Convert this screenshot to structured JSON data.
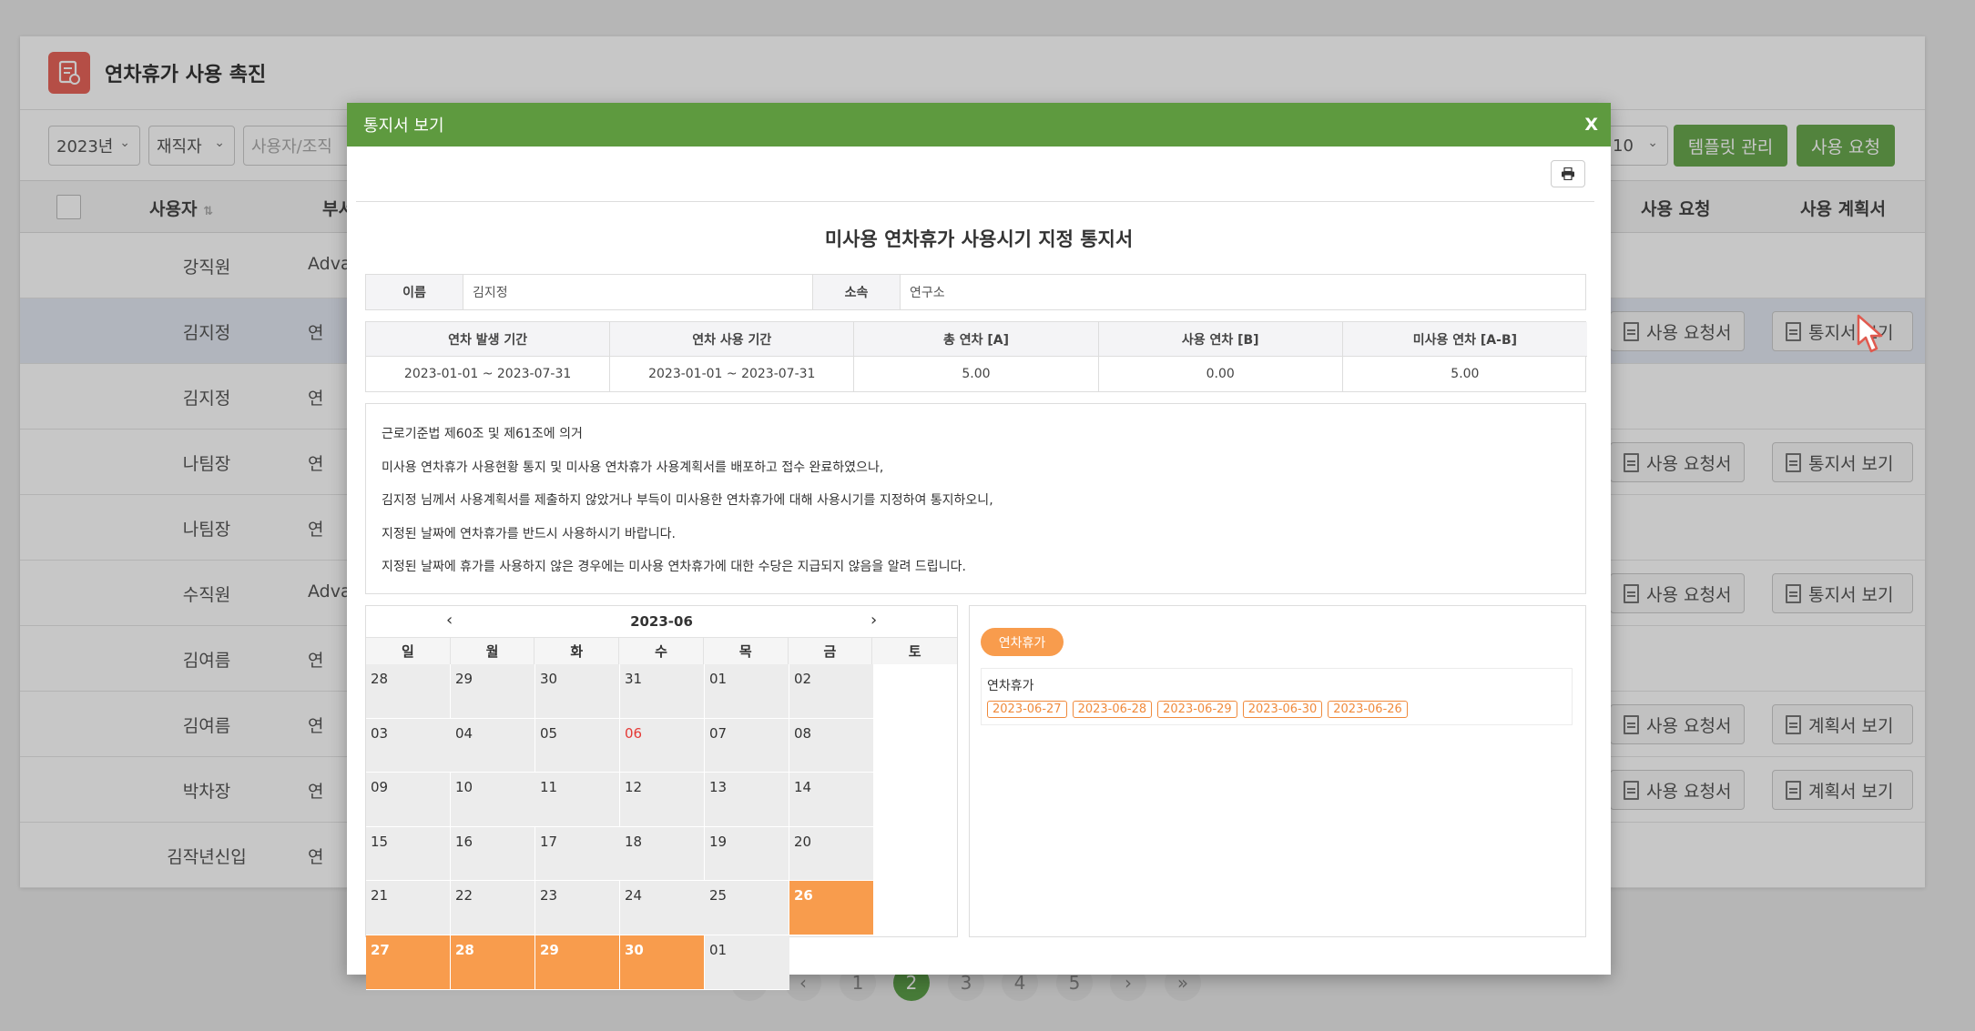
{
  "page": {
    "title": "연차휴가 사용 촉진",
    "toolbar": {
      "year": "2023년",
      "status": "재직자",
      "search_placeholder": "사용자/조직",
      "page_size": "10",
      "template_button": "템플릿 관리",
      "request_button": "사용 요청"
    },
    "table": {
      "headers": {
        "user": "사용자",
        "dept": "부서",
        "request": "사용 요청",
        "plan": "사용 계획서"
      },
      "rows": [
        {
          "user": "강직원",
          "dept": "Adva",
          "req": "",
          "plan": ""
        },
        {
          "user": "김지정",
          "dept": "연",
          "req": "사용 요청서",
          "plan": "통지서 보기"
        },
        {
          "user": "김지정",
          "dept": "연",
          "req": "",
          "plan": ""
        },
        {
          "user": "나팀장",
          "dept": "연",
          "req": "사용 요청서",
          "plan": "통지서 보기"
        },
        {
          "user": "나팀장",
          "dept": "연",
          "req": "",
          "plan": ""
        },
        {
          "user": "수직원",
          "dept": "Adva",
          "req": "사용 요청서",
          "plan": "통지서 보기"
        },
        {
          "user": "김여름",
          "dept": "연",
          "req": "",
          "plan": ""
        },
        {
          "user": "김여름",
          "dept": "연",
          "req": "사용 요청서",
          "plan": "계획서 보기"
        },
        {
          "user": "박차장",
          "dept": "연",
          "req": "사용 요청서",
          "plan": "계획서 보기"
        },
        {
          "user": "김작년신입",
          "dept": "연",
          "req": "",
          "plan": ""
        }
      ]
    },
    "pagination": {
      "first": "«",
      "prev": "‹",
      "pages": [
        "1",
        "2",
        "3",
        "4",
        "5"
      ],
      "next": "›",
      "last": "»",
      "current": "2"
    }
  },
  "modal": {
    "title": "통지서 보기",
    "close": "X",
    "doc_title": "미사용 연차휴가 사용시기 지정 통지서",
    "info": {
      "name_label": "이름",
      "name": "김지정",
      "dept_label": "소속",
      "dept": "연구소"
    },
    "leave_table": {
      "headers": [
        "연차 발생 기간",
        "연차 사용 기간",
        "총 연차 [A]",
        "사용 연차 [B]",
        "미사용 연차 [A-B]"
      ],
      "values": [
        "2023-01-01 ~ 2023-07-31",
        "2023-01-01 ~ 2023-07-31",
        "5.00",
        "0.00",
        "5.00"
      ]
    },
    "notice": [
      "근로기준법 제60조 및 제61조에 의거",
      "미사용 연차휴가 사용현황 통지 및 미사용 연차휴가 사용계획서를 배포하고 접수 완료하였으나,",
      "김지정 님께서 사용계획서를 제출하지 않았거나 부득이 미사용한 연차휴가에 대해 사용시기를 지정하여 통지하오니,",
      "지정된 날짜에 연차휴가를 반드시 사용하시기 바랍니다.",
      "지정된 날짜에 휴가를 사용하지 않은 경우에는 미사용 연차휴가에 대한 수당은 지급되지 않음을 알려 드립니다."
    ],
    "calendar": {
      "month": "2023-06",
      "prev": "‹",
      "next": "›",
      "weekdays": [
        "일",
        "월",
        "화",
        "수",
        "목",
        "금",
        "토"
      ],
      "days": [
        {
          "d": "28"
        },
        {
          "d": "29"
        },
        {
          "d": "30"
        },
        {
          "d": "31"
        },
        {
          "d": "01"
        },
        {
          "d": "02"
        },
        {
          "d": "03"
        },
        {
          "d": "04"
        },
        {
          "d": "05"
        },
        {
          "d": "06",
          "red": true
        },
        {
          "d": "07"
        },
        {
          "d": "08"
        },
        {
          "d": "09"
        },
        {
          "d": "10"
        },
        {
          "d": "11"
        },
        {
          "d": "12"
        },
        {
          "d": "13"
        },
        {
          "d": "14"
        },
        {
          "d": "15"
        },
        {
          "d": "16"
        },
        {
          "d": "17"
        },
        {
          "d": "18"
        },
        {
          "d": "19"
        },
        {
          "d": "20"
        },
        {
          "d": "21"
        },
        {
          "d": "22"
        },
        {
          "d": "23"
        },
        {
          "d": "24"
        },
        {
          "d": "25"
        },
        {
          "d": "26",
          "sel": true
        },
        {
          "d": "27",
          "sel": true
        },
        {
          "d": "28",
          "sel": true
        },
        {
          "d": "29",
          "sel": true
        },
        {
          "d": "30",
          "sel": true
        },
        {
          "d": "01"
        }
      ]
    },
    "side": {
      "badge": "연차휴가",
      "label": "연차휴가",
      "dates": [
        "2023-06-27",
        "2023-06-28",
        "2023-06-29",
        "2023-06-30",
        "2023-06-26"
      ]
    }
  },
  "colors": {
    "header_green": "#5e9a3f",
    "button_green": "#6aa84f",
    "accent_orange": "#f89c4d",
    "holiday_red": "#e53935"
  }
}
